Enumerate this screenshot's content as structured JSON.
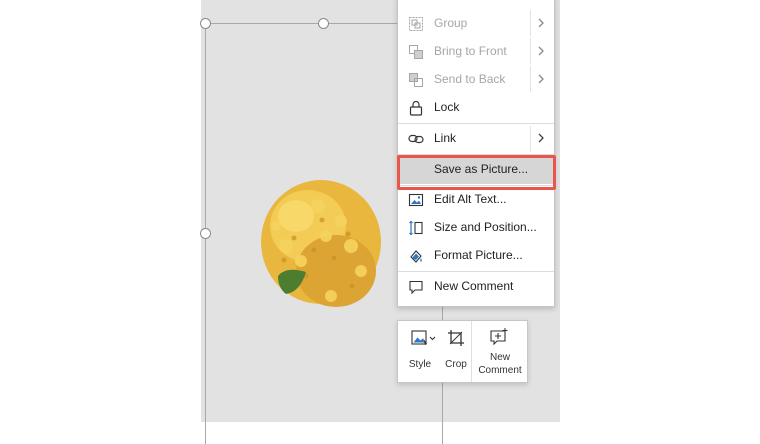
{
  "menu": {
    "items": [
      {
        "label": "Group",
        "disabled": true,
        "icon": "group-icon"
      },
      {
        "label": "Bring to Front",
        "disabled": true,
        "icon": "bring-to-front-icon"
      },
      {
        "label": "Send to Back",
        "disabled": true,
        "icon": "send-to-back-icon"
      },
      {
        "label": "Lock",
        "disabled": false,
        "icon": "lock-icon"
      },
      {
        "label": "Link",
        "disabled": false,
        "icon": "link-icon"
      },
      {
        "label": "Save as Picture...",
        "disabled": false,
        "icon": null,
        "highlighted": true
      },
      {
        "label": "Edit Alt Text...",
        "disabled": false,
        "icon": "alt-text-icon"
      },
      {
        "label": "Size and Position...",
        "disabled": false,
        "icon": "size-position-icon"
      },
      {
        "label": "Format Picture...",
        "disabled": false,
        "icon": "format-picture-icon"
      },
      {
        "label": "New Comment",
        "disabled": false,
        "icon": "comment-icon"
      }
    ]
  },
  "toolbar": {
    "style_label": "Style",
    "crop_label": "Crop",
    "new_comment_label_line1": "New",
    "new_comment_label_line2": "Comment"
  },
  "colors": {
    "highlight_border": "#e9564a",
    "canvas_bg": "#e2e2e2",
    "accent_blue": "#2b78c5"
  }
}
